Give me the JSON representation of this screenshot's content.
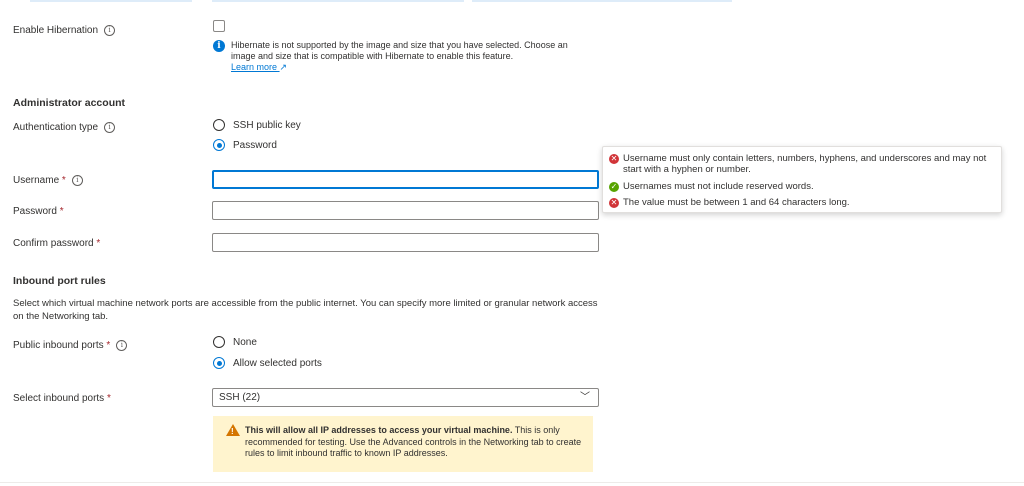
{
  "hibernation": {
    "label": "Enable Hibernation",
    "info_icon": "info-icon",
    "message": "Hibernate is not supported by the image and size that you have selected. Choose an image and size that is compatible with Hibernate to enable this feature.",
    "learn_more": "Learn more",
    "learn_more_icon": "↗"
  },
  "admin": {
    "title": "Administrator account",
    "auth_type_label": "Authentication type",
    "auth_options": [
      "SSH public key",
      "Password"
    ],
    "auth_selected": "Password",
    "username_label": "Username",
    "password_label": "Password",
    "confirm_label": "Confirm password",
    "required_marker": "*",
    "username_value": "",
    "password_value": "",
    "confirm_value": ""
  },
  "validation": {
    "rules": [
      {
        "status": "error",
        "text": "Username must only contain letters, numbers, hyphens, and underscores and may not start with a hyphen or number."
      },
      {
        "status": "success",
        "text": "Usernames must not include reserved words."
      },
      {
        "status": "error",
        "text": "The value must be between 1 and 64 characters long."
      }
    ],
    "error_color": "#d13438",
    "success_color": "#57a300"
  },
  "inbound": {
    "title": "Inbound port rules",
    "description": "Select which virtual machine network ports are accessible from the public internet. You can specify more limited or granular network access on the Networking tab.",
    "public_label": "Public inbound ports",
    "public_options": [
      "None",
      "Allow selected ports"
    ],
    "public_selected": "Allow selected ports",
    "select_label": "Select inbound ports",
    "select_value": "SSH (22)",
    "warning_bold": "This will allow all IP addresses to access your virtual machine.",
    "warning_rest": "  This is only recommended for testing.  Use the Advanced controls in the Networking tab to create rules to limit inbound traffic to known IP addresses."
  },
  "colors": {
    "accent": "#0078d4",
    "warning_bg": "#fff4ce",
    "warning_icon": "#d47500"
  }
}
